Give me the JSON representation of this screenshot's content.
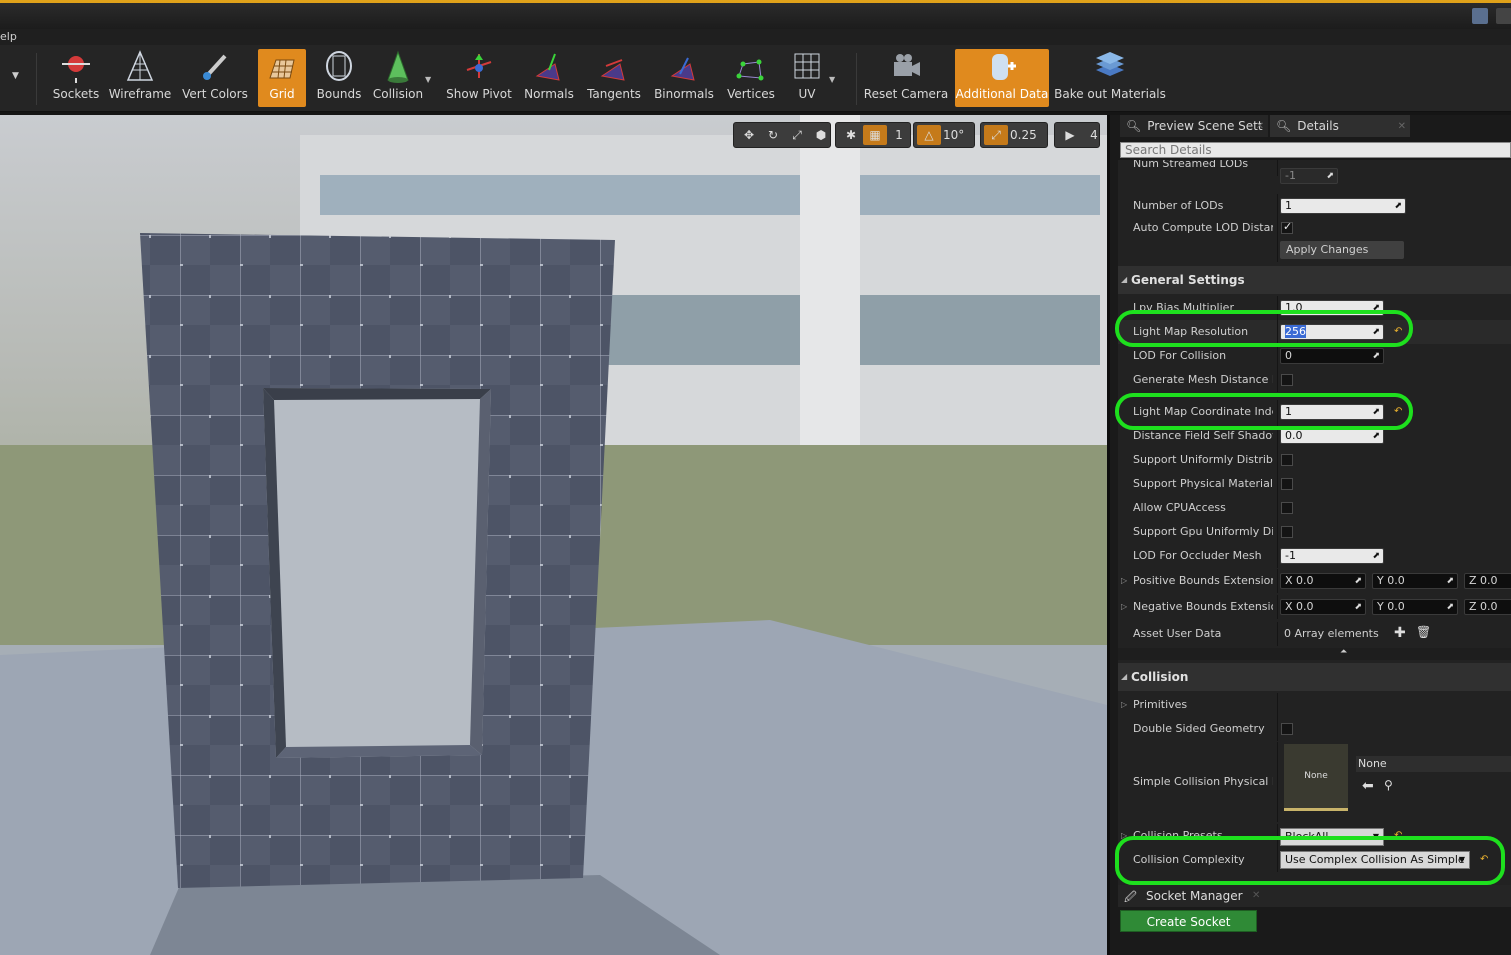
{
  "menubar": {
    "help_partial": "elp"
  },
  "toolbar": {
    "items": [
      {
        "label": "Sockets"
      },
      {
        "label": "Wireframe"
      },
      {
        "label": "Vert Colors"
      },
      {
        "label": "Grid"
      },
      {
        "label": "Bounds"
      },
      {
        "label": "Collision"
      },
      {
        "label": "Show Pivot"
      },
      {
        "label": "Normals"
      },
      {
        "label": "Tangents"
      },
      {
        "label": "Binormals"
      },
      {
        "label": "Vertices"
      },
      {
        "label": "UV"
      },
      {
        "label": "Reset Camera"
      },
      {
        "label": "Additional Data"
      },
      {
        "label": "Bake out Materials"
      }
    ],
    "accent": "#e08a1e"
  },
  "viewport": {
    "grid_size": "1",
    "rotation_snap": "10°",
    "scale_snap": "0.25",
    "camera_speed": "4"
  },
  "panel": {
    "tabs": [
      {
        "label": "Preview Scene Sett"
      },
      {
        "label": "Details"
      }
    ],
    "search_placeholder": "Search Details",
    "lod": {
      "num_streamed_lods_label": "Num Streamed LODs",
      "num_streamed_lods_value": "-1",
      "number_of_lods_label": "Number of LODs",
      "number_of_lods_value": "1",
      "auto_compute_label": "Auto Compute LOD Distance",
      "apply_changes": "Apply Changes"
    },
    "general": {
      "title": "General Settings",
      "lpv_bias_label": "Lpv Bias Multiplier",
      "lpv_bias_value": "1.0",
      "light_map_res_label": "Light Map Resolution",
      "light_map_res_value": "256",
      "lod_for_collision_label": "LOD For Collision",
      "lod_for_collision_value": "0",
      "gen_mesh_dist_label": "Generate Mesh Distance Fiel",
      "light_map_coord_label": "Light Map Coordinate Index",
      "light_map_coord_value": "1",
      "dist_field_shadow_label": "Distance Field Self Shadow B",
      "dist_field_shadow_value": "0.0",
      "support_uniform_label": "Support Uniformly Distribute",
      "support_physical_label": "Support Physical Material M",
      "allow_cpu_label": "Allow CPUAccess",
      "support_gpu_label": "Support Gpu Uniformly Distri",
      "lod_occluder_label": "LOD For Occluder Mesh",
      "lod_occluder_value": "-1",
      "pos_bounds_label": "Positive Bounds Extension",
      "neg_bounds_label": "Negative Bounds Extension",
      "x_value": "0.0",
      "y_value": "0.0",
      "z_value": "0.0",
      "x_prefix": "X",
      "y_prefix": "Y",
      "z_prefix": "Z",
      "asset_user_data_label": "Asset User Data",
      "asset_user_data_value": "0 Array elements"
    },
    "collision": {
      "title": "Collision",
      "primitives_label": "Primitives",
      "double_sided_label": "Double Sided Geometry",
      "simple_phys_label": "Simple Collision Physical Ma",
      "thumb_text": "None",
      "phys_value": "None",
      "presets_label": "Collision Presets",
      "presets_value": "BlockAll",
      "complexity_label": "Collision Complexity",
      "complexity_value": "Use Complex Collision As Simple"
    },
    "socket_manager": {
      "title": "Socket Manager",
      "create_button": "Create Socket"
    },
    "highlight_color": "#1ee01e"
  }
}
